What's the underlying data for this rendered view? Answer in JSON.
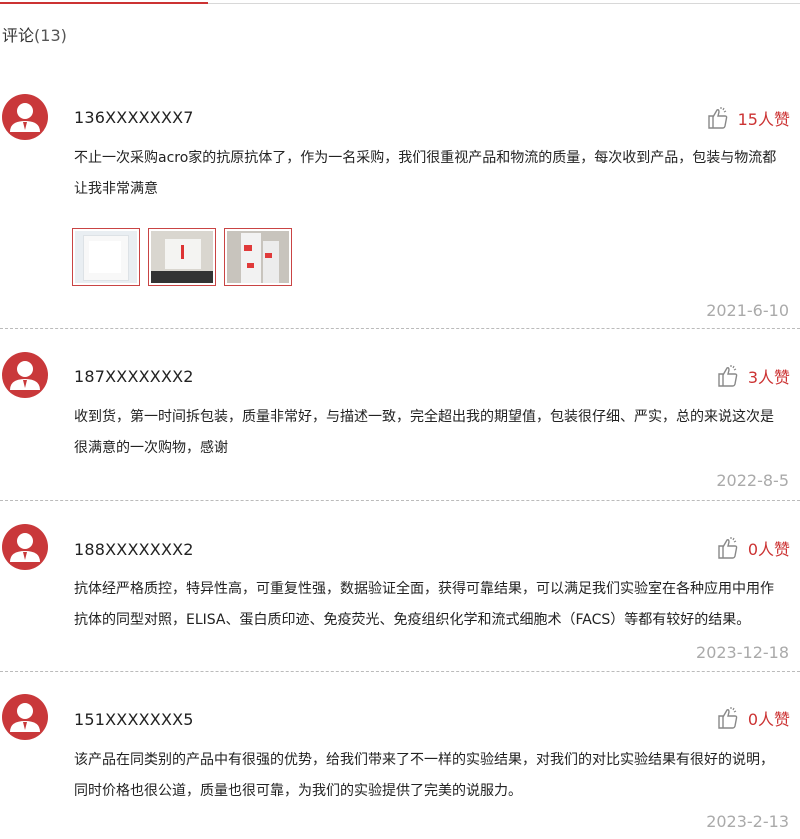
{
  "header": {
    "title": "评论",
    "count": "(13)"
  },
  "comments": [
    {
      "user": "136XXXXXXX7",
      "likes": "15人赞",
      "text": "不止一次采购acro家的抗原抗体了，作为一名采购，我们很重视产品和物流的质量，每次收到产品，包装与物流都让我非常满意",
      "date": "2021-6-10",
      "photo_icons": [
        "white-box-photo",
        "package-box-photo",
        "lab-tubes-photo"
      ]
    },
    {
      "user": "187XXXXXXX2",
      "likes": "3人赞",
      "text": "收到货，第一时间拆包装，质量非常好，与描述一致，完全超出我的期望值，包装很仔细、严实，总的来说这次是很满意的一次购物，感谢",
      "date": "2022-8-5"
    },
    {
      "user": "188XXXXXXX2",
      "likes": "0人赞",
      "text": "抗体经严格质控，特异性高，可重复性强，数据验证全面，获得可靠结果，可以满足我们实验室在各种应用中用作抗体的同型对照，ELISA、蛋白质印迹、免疫荧光、免疫组织化学和流式细胞术（FACS）等都有较好的结果。",
      "date": "2023-12-18"
    },
    {
      "user": "151XXXXXXX5",
      "likes": "0人赞",
      "text": "该产品在同类别的产品中有很强的优势，给我们带来了不一样的实验结果，对我们的对比实验结果有很好的说明，同时价格也很公道，质量也很可靠，为我们的实验提供了完美的说服力。",
      "date": "2023-2-13"
    }
  ],
  "colors": {
    "accent": "#cc3333",
    "avatar_bg": "#c9383a",
    "date": "#aaaaaa",
    "divider": "#bbbbbb"
  },
  "icons": {
    "avatar": "user-avatar-icon",
    "like": "thumbs-up-icon"
  }
}
